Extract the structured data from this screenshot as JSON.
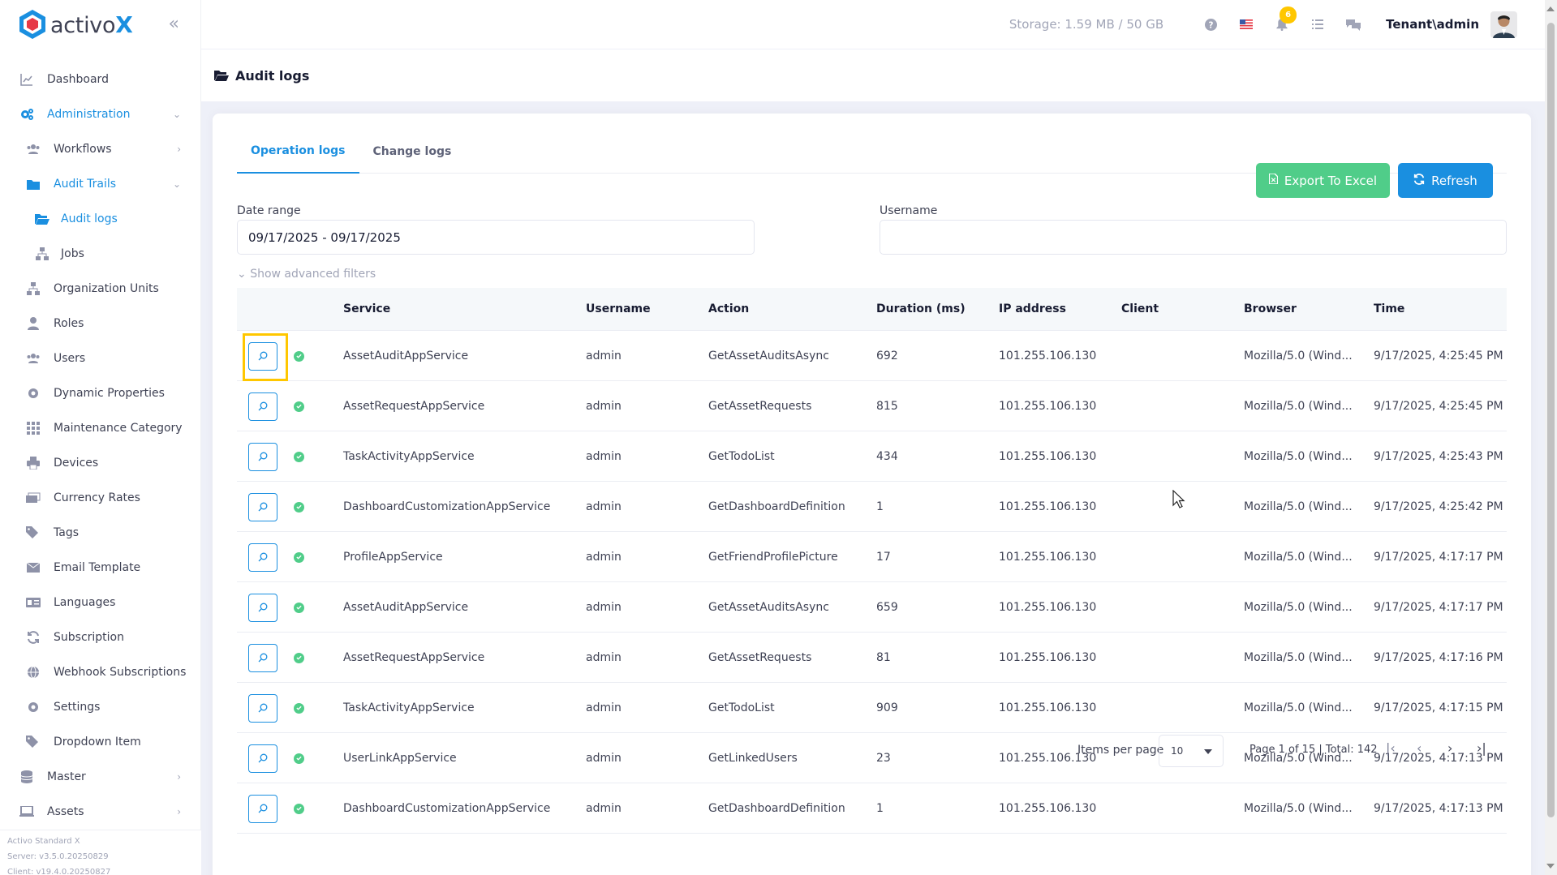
{
  "brand": {
    "name": "activo",
    "name_x": "X"
  },
  "sidebar": {
    "items": [
      {
        "label": "Dashboard",
        "icon": "chart-line-icon"
      },
      {
        "label": "Administration",
        "icon": "gears-icon",
        "chevron": "down"
      },
      {
        "label": "Workflows",
        "icon": "users-icon",
        "chevron": "right"
      },
      {
        "label": "Audit Trails",
        "icon": "folder-icon",
        "chevron": "down"
      },
      {
        "label": "Audit logs",
        "icon": "folder-open-icon"
      },
      {
        "label": "Jobs",
        "icon": "sitemap-icon"
      },
      {
        "label": "Organization Units",
        "icon": "sitemap-icon"
      },
      {
        "label": "Roles",
        "icon": "user-tie-icon"
      },
      {
        "label": "Users",
        "icon": "users-icon"
      },
      {
        "label": "Dynamic Properties",
        "icon": "cog-icon"
      },
      {
        "label": "Maintenance Category",
        "icon": "grid-icon"
      },
      {
        "label": "Devices",
        "icon": "printer-icon"
      },
      {
        "label": "Currency Rates",
        "icon": "money-icon"
      },
      {
        "label": "Tags",
        "icon": "tags-icon"
      },
      {
        "label": "Email Template",
        "icon": "envelope-icon"
      },
      {
        "label": "Languages",
        "icon": "language-icon"
      },
      {
        "label": "Subscription",
        "icon": "sync-icon"
      },
      {
        "label": "Webhook Subscriptions",
        "icon": "globe-icon"
      },
      {
        "label": "Settings",
        "icon": "cog-icon"
      },
      {
        "label": "Dropdown Item",
        "icon": "tags-icon"
      },
      {
        "label": "Master",
        "icon": "database-icon",
        "chevron": "right"
      },
      {
        "label": "Assets",
        "icon": "laptop-icon",
        "chevron": "right"
      }
    ],
    "footer": {
      "product": "Activo Standard X",
      "server": "Server: v3.5.0.20250829",
      "client": "Client: v19.4.0.20250827"
    }
  },
  "header": {
    "storage": "Storage: 1.59 MB / 50 GB",
    "notification_count": "6",
    "user": "Tenant\\admin"
  },
  "page": {
    "title": "Audit logs"
  },
  "tabs": [
    {
      "label": "Operation logs",
      "active": true
    },
    {
      "label": "Change logs",
      "active": false
    }
  ],
  "toolbar": {
    "export_label": "Export To Excel",
    "refresh_label": "Refresh"
  },
  "filters": {
    "date_range_label": "Date range",
    "date_range_value": "09/17/2025 - 09/17/2025",
    "username_label": "Username",
    "username_value": "",
    "advanced": "Show advanced filters"
  },
  "table": {
    "columns": [
      "Service",
      "Username",
      "Action",
      "Duration (ms)",
      "IP address",
      "Client",
      "Browser",
      "Time"
    ],
    "rows": [
      {
        "service": "AssetAuditAppService",
        "username": "admin",
        "action": "GetAssetAuditsAsync",
        "duration": "692",
        "ip": "101.255.106.130",
        "client": "",
        "browser": "Mozilla/5.0 (Wind...",
        "time": "9/17/2025, 4:25:45 PM"
      },
      {
        "service": "AssetRequestAppService",
        "username": "admin",
        "action": "GetAssetRequests",
        "duration": "815",
        "ip": "101.255.106.130",
        "client": "",
        "browser": "Mozilla/5.0 (Wind...",
        "time": "9/17/2025, 4:25:45 PM"
      },
      {
        "service": "TaskActivityAppService",
        "username": "admin",
        "action": "GetTodoList",
        "duration": "434",
        "ip": "101.255.106.130",
        "client": "",
        "browser": "Mozilla/5.0 (Wind...",
        "time": "9/17/2025, 4:25:43 PM"
      },
      {
        "service": "DashboardCustomizationAppService",
        "username": "admin",
        "action": "GetDashboardDefinition",
        "duration": "1",
        "ip": "101.255.106.130",
        "client": "",
        "browser": "Mozilla/5.0 (Wind...",
        "time": "9/17/2025, 4:25:42 PM"
      },
      {
        "service": "ProfileAppService",
        "username": "admin",
        "action": "GetFriendProfilePicture",
        "duration": "17",
        "ip": "101.255.106.130",
        "client": "",
        "browser": "Mozilla/5.0 (Wind...",
        "time": "9/17/2025, 4:17:17 PM"
      },
      {
        "service": "AssetAuditAppService",
        "username": "admin",
        "action": "GetAssetAuditsAsync",
        "duration": "659",
        "ip": "101.255.106.130",
        "client": "",
        "browser": "Mozilla/5.0 (Wind...",
        "time": "9/17/2025, 4:17:17 PM"
      },
      {
        "service": "AssetRequestAppService",
        "username": "admin",
        "action": "GetAssetRequests",
        "duration": "81",
        "ip": "101.255.106.130",
        "client": "",
        "browser": "Mozilla/5.0 (Wind...",
        "time": "9/17/2025, 4:17:16 PM"
      },
      {
        "service": "TaskActivityAppService",
        "username": "admin",
        "action": "GetTodoList",
        "duration": "909",
        "ip": "101.255.106.130",
        "client": "",
        "browser": "Mozilla/5.0 (Wind...",
        "time": "9/17/2025, 4:17:15 PM"
      },
      {
        "service": "UserLinkAppService",
        "username": "admin",
        "action": "GetLinkedUsers",
        "duration": "23",
        "ip": "101.255.106.130",
        "client": "",
        "browser": "Mozilla/5.0 (Wind...",
        "time": "9/17/2025, 4:17:13 PM"
      },
      {
        "service": "DashboardCustomizationAppService",
        "username": "admin",
        "action": "GetDashboardDefinition",
        "duration": "1",
        "ip": "101.255.106.130",
        "client": "",
        "browser": "Mozilla/5.0 (Wind...",
        "time": "9/17/2025, 4:17:13 PM"
      }
    ]
  },
  "pagination": {
    "items_per_page_label": "Items per page",
    "items_per_page": "10",
    "info": "Page 1 of 15 | Total: 142"
  },
  "colors": {
    "primary": "#1a8fe0",
    "success": "#50cd89",
    "warning": "#ffc700",
    "highlight": "#ffc700"
  }
}
